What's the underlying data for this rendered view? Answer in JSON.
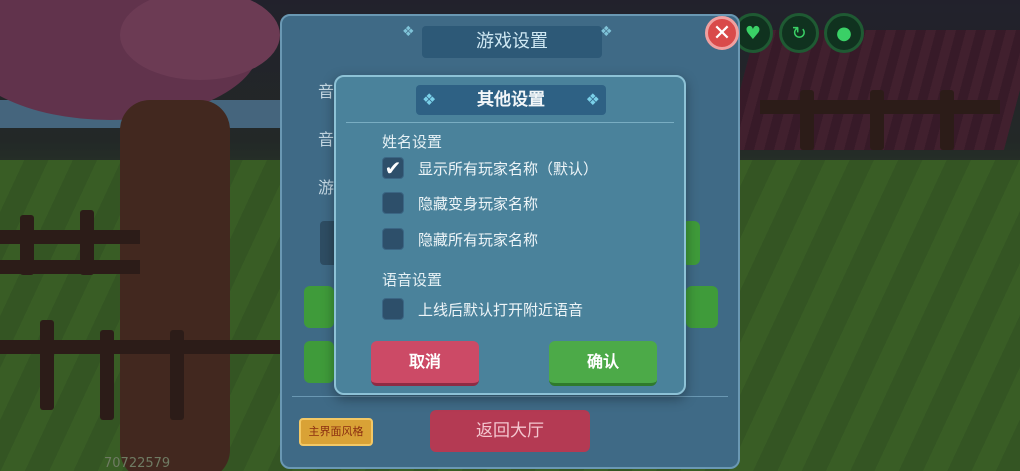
{
  "main_panel": {
    "title": "游戏设置",
    "bg_labels": [
      "音",
      "音",
      "游"
    ],
    "skin_button": "主界面风格",
    "lobby_button": "返回大厅",
    "player_id": "70722579"
  },
  "dialog": {
    "title": "其他设置",
    "name_section": "姓名设置",
    "name_options": [
      {
        "label": "显示所有玩家名称（默认）",
        "checked": true
      },
      {
        "label": "隐藏变身玩家名称",
        "checked": false
      },
      {
        "label": "隐藏所有玩家名称",
        "checked": false
      }
    ],
    "voice_section": "语音设置",
    "voice_options": [
      {
        "label": "上线后默认打开附近语音",
        "checked": false
      }
    ],
    "cancel_label": "取消",
    "confirm_label": "确认"
  },
  "icons": {
    "close": "close-icon",
    "heart": "heart-icon",
    "arrow": "arrow-icon",
    "drop": "water-drop-icon",
    "check": "check-icon"
  },
  "colors": {
    "cancel": "#cc4a66",
    "confirm": "#4caa48",
    "panel": "#3f6a86"
  }
}
